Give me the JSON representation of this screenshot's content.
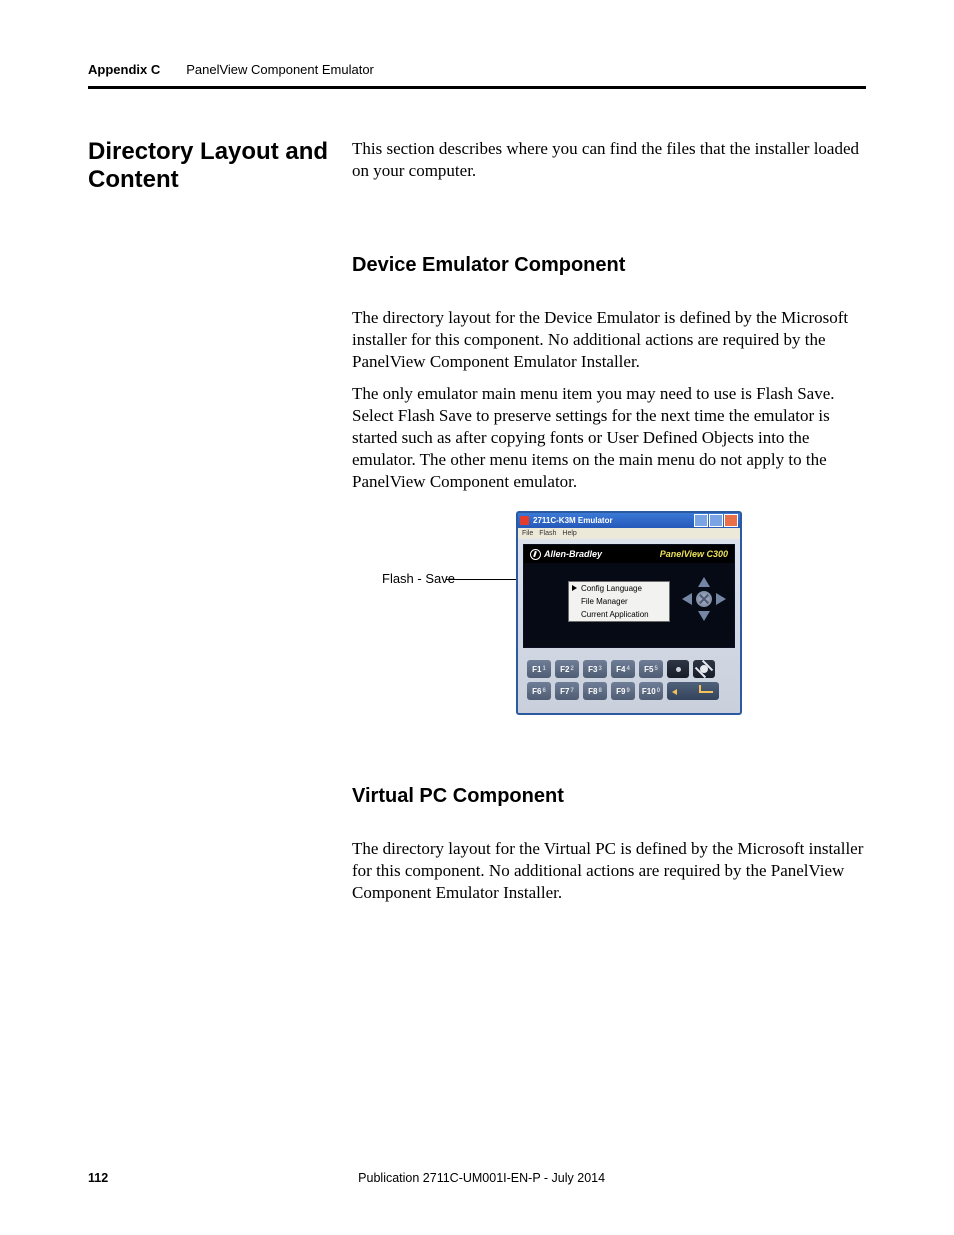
{
  "header": {
    "appendix": "Appendix C",
    "section": "PanelView Component Emulator"
  },
  "sidebar_heading": "Directory Layout and Content",
  "intro": "This section describes where you can find the files that the installer loaded on your computer.",
  "sec1": {
    "heading": "Device Emulator Component",
    "p1": "The directory layout for the Device Emulator is defined by the Microsoft installer for this component. No additional actions are required by the PanelView Component Emulator Installer.",
    "p2": "The only emulator main menu item you may need to use is Flash Save. Select Flash Save to preserve settings for the next time the emulator is started such as after copying fonts or User Defined Objects into the emulator. The other menu items on the main menu do not apply to the PanelView Component emulator."
  },
  "figure": {
    "callout": "Flash - Save",
    "window_title": "2711C-K3M Emulator",
    "menu": {
      "file": "File",
      "flash": "Flash",
      "help": "Help"
    },
    "brand": "Allen-Bradley",
    "device": "PanelView C300",
    "items": [
      "Config Language",
      "File Manager",
      "Current Application"
    ],
    "fkeys_row1": [
      "F1",
      "F2",
      "F3",
      "F4",
      "F5"
    ],
    "fkeys_row1_sub": [
      "1",
      "2",
      "3",
      "4",
      "5"
    ],
    "fkeys_row2": [
      "F6",
      "F7",
      "F8",
      "F9",
      "F10"
    ],
    "fkeys_row2_sub": [
      "6",
      "7",
      "8",
      "9",
      "0"
    ]
  },
  "sec2": {
    "heading": "Virtual PC Component",
    "p1": "The directory layout for the Virtual PC is defined by the Microsoft installer for this component. No additional actions are required by the PanelView Component Emulator Installer."
  },
  "footer": {
    "page": "112",
    "pub": "Publication 2711C-UM001I-EN-P - July 2014"
  }
}
